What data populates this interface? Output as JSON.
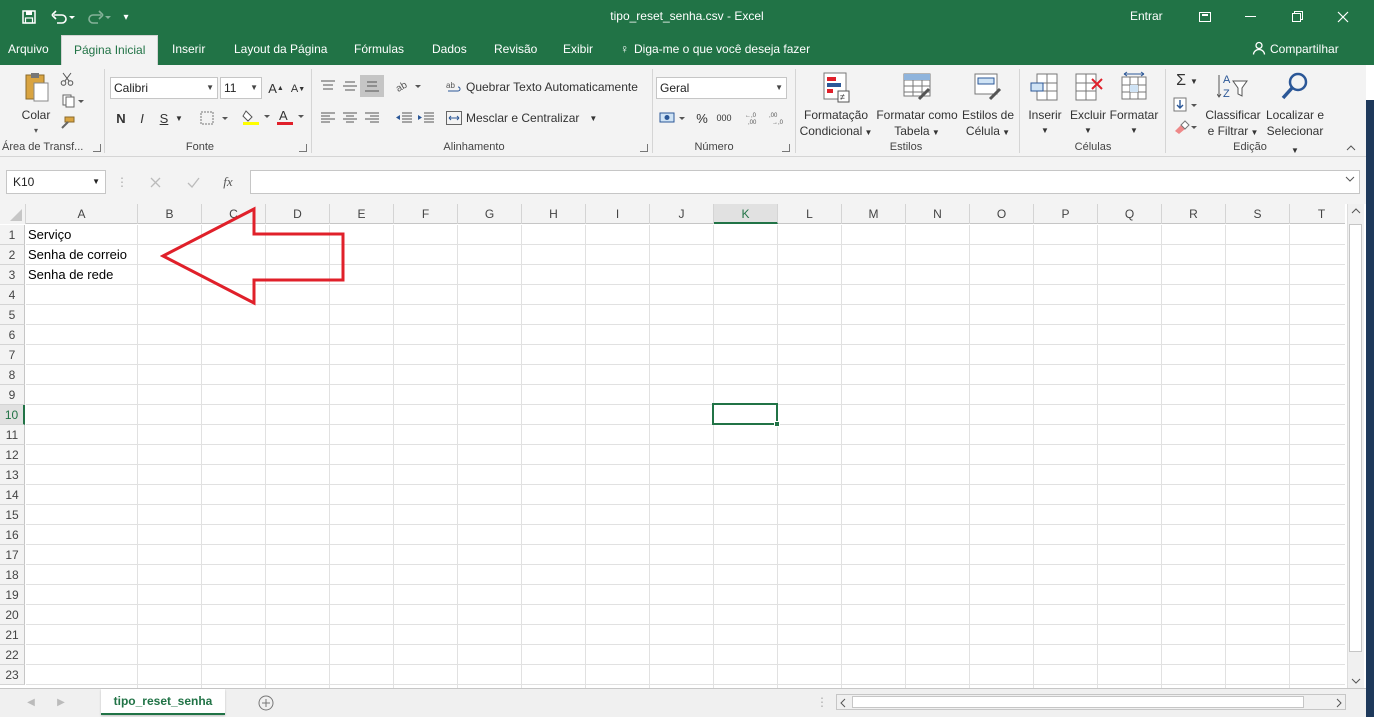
{
  "window": {
    "title": "tipo_reset_senha.csv  -  Excel",
    "signin": "Entrar",
    "controls": [
      "ribbon-options",
      "minimize",
      "restore",
      "close"
    ]
  },
  "tabs": [
    "Arquivo",
    "Página Inicial",
    "Inserir",
    "Layout da Página",
    "Fórmulas",
    "Dados",
    "Revisão",
    "Exibir"
  ],
  "active_tab": "Página Inicial",
  "tell_me": "Diga-me o que você deseja fazer",
  "share": "Compartilhar",
  "ribbon": {
    "clipboard": {
      "paste": "Colar",
      "label": "Área de Transf..."
    },
    "font": {
      "name": "Calibri",
      "size": "11",
      "bold": "N",
      "italic": "I",
      "underline": "S",
      "label": "Fonte"
    },
    "alignment": {
      "wrap": "Quebrar Texto Automaticamente",
      "merge": "Mesclar e Centralizar",
      "label": "Alinhamento"
    },
    "number": {
      "format": "Geral",
      "label": "Número"
    },
    "styles": {
      "conditional_1": "Formatação",
      "conditional_2": "Condicional",
      "table_1": "Formatar como",
      "table_2": "Tabela",
      "cell_1": "Estilos de",
      "cell_2": "Célula",
      "label": "Estilos"
    },
    "cells": {
      "insert": "Inserir",
      "delete": "Excluir",
      "format": "Formatar",
      "label": "Células"
    },
    "editing": {
      "sort_1": "Classificar",
      "sort_2": "e Filtrar",
      "find_1": "Localizar e",
      "find_2": "Selecionar",
      "label": "Edição"
    }
  },
  "formula_bar": {
    "name_box": "K10",
    "formula": "",
    "fx": "fx"
  },
  "columns": [
    "A",
    "B",
    "C",
    "D",
    "E",
    "F",
    "G",
    "H",
    "I",
    "J",
    "K",
    "L",
    "M",
    "N",
    "O",
    "P",
    "Q",
    "R",
    "S",
    "T"
  ],
  "selected_column": "K",
  "rows": [
    "1",
    "2",
    "3",
    "4",
    "5",
    "6",
    "7",
    "8",
    "9",
    "10",
    "11",
    "12",
    "13",
    "14",
    "15",
    "16",
    "17",
    "18",
    "19",
    "20",
    "21",
    "22",
    "23"
  ],
  "selected_row": "10",
  "cells": {
    "A1": "Serviço",
    "A2": "Senha de correio",
    "A3": "Senha de rede"
  },
  "annotation": {
    "color": "#e0202a"
  },
  "sheet": {
    "name": "tipo_reset_senha"
  },
  "theme": {
    "accent": "#217346"
  }
}
